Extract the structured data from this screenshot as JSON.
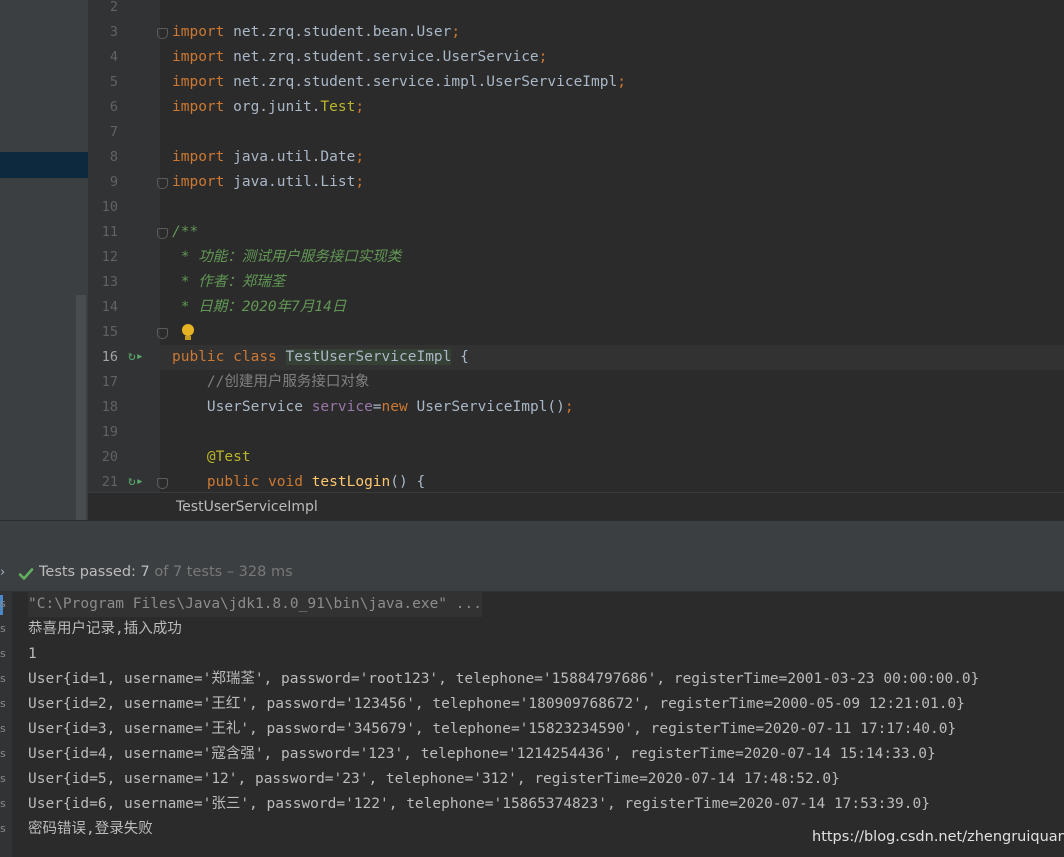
{
  "editor": {
    "lines": [
      {
        "no": "2",
        "tokens": []
      },
      {
        "no": "3",
        "tokens": [
          {
            "t": "import",
            "c": "kw"
          },
          {
            "t": " net.zrq.student.bean.User"
          },
          {
            "t": ";",
            "c": "kw"
          }
        ]
      },
      {
        "no": "4",
        "tokens": [
          {
            "t": "import",
            "c": "kw"
          },
          {
            "t": " net.zrq.student.service.UserService"
          },
          {
            "t": ";",
            "c": "kw"
          }
        ]
      },
      {
        "no": "5",
        "tokens": [
          {
            "t": "import",
            "c": "kw"
          },
          {
            "t": " net.zrq.student.service.impl.UserServiceImpl"
          },
          {
            "t": ";",
            "c": "kw"
          }
        ]
      },
      {
        "no": "6",
        "tokens": [
          {
            "t": "import",
            "c": "kw"
          },
          {
            "t": " org.junit."
          },
          {
            "t": "Test",
            "c": "ann"
          },
          {
            "t": ";",
            "c": "kw"
          }
        ]
      },
      {
        "no": "7",
        "tokens": []
      },
      {
        "no": "8",
        "tokens": [
          {
            "t": "import",
            "c": "kw"
          },
          {
            "t": " java.util.Date"
          },
          {
            "t": ";",
            "c": "kw"
          }
        ]
      },
      {
        "no": "9",
        "tokens": [
          {
            "t": "import",
            "c": "kw"
          },
          {
            "t": " java.util.List"
          },
          {
            "t": ";",
            "c": "kw"
          }
        ]
      },
      {
        "no": "10",
        "tokens": []
      },
      {
        "no": "11",
        "tokens": [
          {
            "t": "/**",
            "c": "doc"
          }
        ]
      },
      {
        "no": "12",
        "tokens": [
          {
            "t": " * 功能：测试用户服务接口实现类",
            "c": "doc"
          }
        ]
      },
      {
        "no": "13",
        "tokens": [
          {
            "t": " * 作者：郑瑞荃",
            "c": "doc"
          }
        ]
      },
      {
        "no": "14",
        "tokens": [
          {
            "t": " * 日期：2020年7月14日",
            "c": "doc"
          }
        ]
      },
      {
        "no": "15",
        "tokens": []
      },
      {
        "no": "16",
        "tokens": [
          {
            "t": "public",
            "c": "kw"
          },
          {
            "t": " "
          },
          {
            "t": "class",
            "c": "kw"
          },
          {
            "t": " "
          },
          {
            "t": "TestUserServiceImpl",
            "c": "hl-cls"
          },
          {
            "t": " {"
          }
        ]
      },
      {
        "no": "17",
        "tokens": [
          {
            "t": "    "
          },
          {
            "t": "//创建用户服务接口对象",
            "c": "cmt"
          }
        ]
      },
      {
        "no": "18",
        "tokens": [
          {
            "t": "    UserService "
          },
          {
            "t": "service",
            "c": "field"
          },
          {
            "t": "="
          },
          {
            "t": "new",
            "c": "kw"
          },
          {
            "t": " UserServiceImpl()"
          },
          {
            "t": ";",
            "c": "kw"
          }
        ]
      },
      {
        "no": "19",
        "tokens": []
      },
      {
        "no": "20",
        "tokens": [
          {
            "t": "    "
          },
          {
            "t": "@Test",
            "c": "ann"
          }
        ]
      },
      {
        "no": "21",
        "tokens": [
          {
            "t": "    "
          },
          {
            "t": "public",
            "c": "kw"
          },
          {
            "t": " "
          },
          {
            "t": "void",
            "c": "kw"
          },
          {
            "t": " "
          },
          {
            "t": "testLogin",
            "c": "method"
          },
          {
            "t": "() {"
          }
        ]
      }
    ],
    "breadcrumb": "TestUserServiceImpl"
  },
  "test_status": {
    "label": "Tests passed: ",
    "passed": "7",
    "detail": " of 7 tests – 328 ms"
  },
  "console": {
    "lines": [
      "\"C:\\Program Files\\Java\\jdk1.8.0_91\\bin\\java.exe\" ...",
      "恭喜用户记录,插入成功",
      "1",
      "User{id=1, username='郑瑞荃', password='root123', telephone='15884797686', registerTime=2001-03-23 00:00:00.0}",
      "User{id=2, username='王红', password='123456', telephone='180909768672', registerTime=2000-05-09 12:21:01.0}",
      "User{id=3, username='王礼', password='345679', telephone='15823234590', registerTime=2020-07-11 17:17:40.0}",
      "User{id=4, username='寇含强', password='123', telephone='1214254436', registerTime=2020-07-14 15:14:33.0}",
      "User{id=5, username='12', password='23', telephone='312', registerTime=2020-07-14 17:48:52.0}",
      "User{id=6, username='张三', password='122', telephone='15865374823', registerTime=2020-07-14 17:53:39.0}",
      "密码错误,登录失败"
    ],
    "gutter_marks": [
      "s",
      "s",
      "s",
      "s",
      "s",
      "s",
      "s",
      "s",
      "s",
      "s"
    ]
  },
  "watermark": "https://blog.csdn.net/zhengruiquan",
  "colors": {
    "keyword": "#cc7832",
    "annotation": "#bbb529",
    "doc_comment": "#629755",
    "line_comment": "#808080",
    "field": "#9876aa",
    "method": "#ffc66d",
    "pass_green": "#5fb15f"
  },
  "icons": {
    "run_gutter": "run-test-icon",
    "intention": "lightbulb-icon",
    "passed": "check-icon",
    "expand": "chevron-right-icon"
  }
}
